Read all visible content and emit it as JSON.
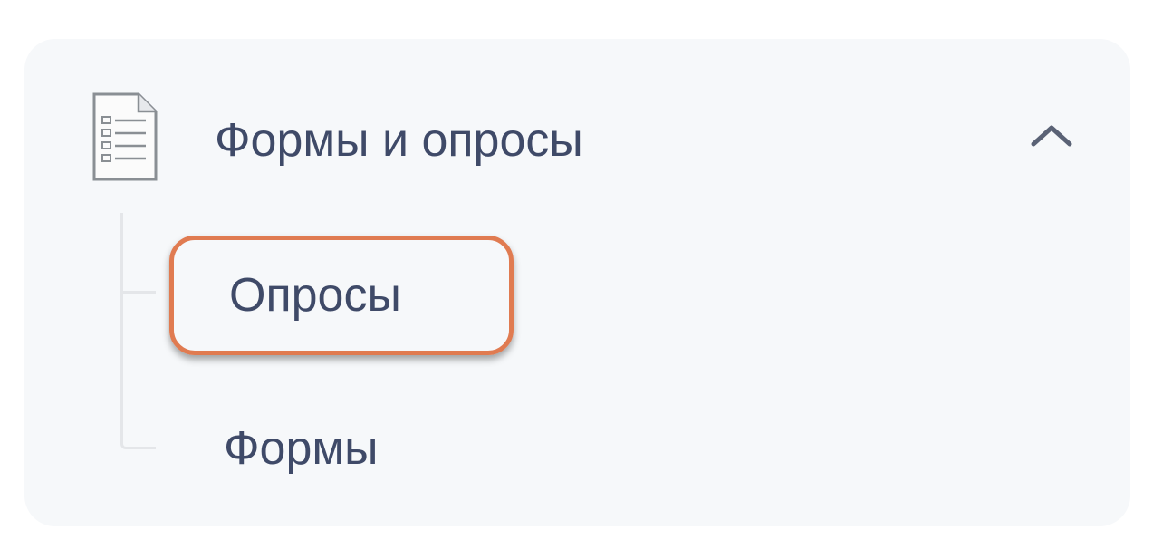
{
  "menu": {
    "label": "Формы и опросы",
    "icon": "form-document-icon",
    "expanded": true,
    "toggle_icon": "chevron-up-icon",
    "items": [
      {
        "label": "Опросы",
        "highlighted": true
      },
      {
        "label": "Формы",
        "highlighted": false
      }
    ]
  },
  "colors": {
    "panel_background": "#f6f8fa",
    "text": "#3f4a68",
    "highlight_border": "#e07b51",
    "tree_line": "#e4e6e9"
  }
}
